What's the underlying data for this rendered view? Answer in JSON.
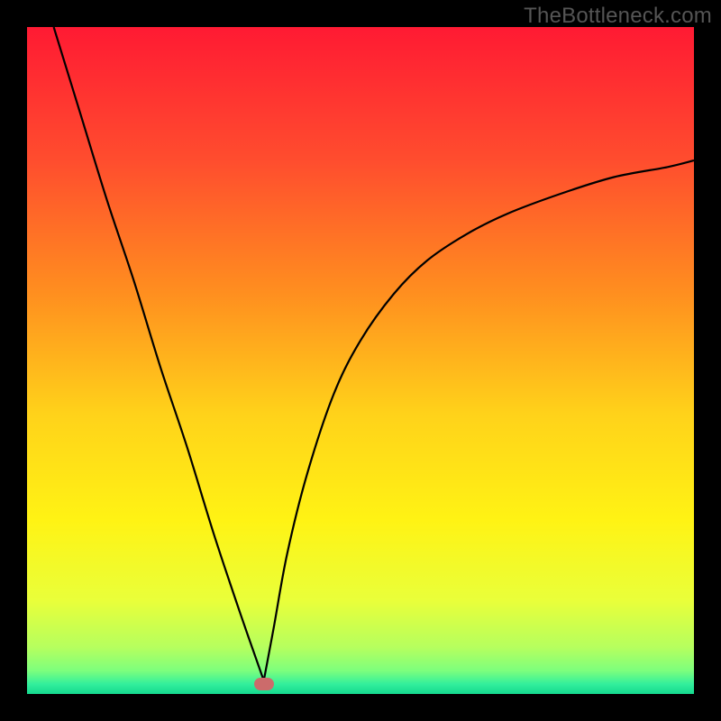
{
  "watermark": "TheBottleneck.com",
  "chart_data": {
    "type": "line",
    "title": "",
    "xlabel": "",
    "ylabel": "",
    "xlim": [
      0,
      100
    ],
    "ylim": [
      0,
      100
    ],
    "grid": false,
    "background": "red-yellow-green-vertical-gradient",
    "series": [
      {
        "name": "left-branch",
        "x": [
          4,
          8,
          12,
          16,
          20,
          24,
          28,
          32,
          35.5
        ],
        "y": [
          100,
          87,
          74,
          62,
          49,
          37,
          24,
          12,
          2
        ]
      },
      {
        "name": "right-branch",
        "x": [
          35.5,
          37,
          39,
          42,
          46,
          50,
          55,
          60,
          66,
          72,
          80,
          88,
          96,
          100
        ],
        "y": [
          2,
          10,
          21,
          33,
          45,
          53,
          60,
          65,
          69,
          72,
          75,
          77.5,
          79,
          80
        ]
      }
    ],
    "marker": {
      "x": 35.5,
      "y": 1.5,
      "color": "#cc6b6b"
    },
    "gradient_stops": [
      {
        "pos": 0.0,
        "color": "#ff1a33"
      },
      {
        "pos": 0.2,
        "color": "#ff4d2e"
      },
      {
        "pos": 0.4,
        "color": "#ff8f1f"
      },
      {
        "pos": 0.58,
        "color": "#ffd21a"
      },
      {
        "pos": 0.74,
        "color": "#fff314"
      },
      {
        "pos": 0.86,
        "color": "#e9ff3a"
      },
      {
        "pos": 0.93,
        "color": "#b6ff5e"
      },
      {
        "pos": 0.965,
        "color": "#7dff7d"
      },
      {
        "pos": 0.985,
        "color": "#33ef9c"
      },
      {
        "pos": 1.0,
        "color": "#14d98f"
      }
    ]
  }
}
